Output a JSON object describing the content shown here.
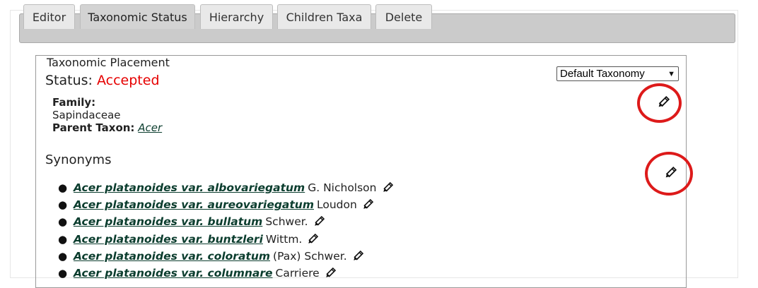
{
  "tabs": [
    {
      "label": "Editor"
    },
    {
      "label": "Taxonomic Status"
    },
    {
      "label": "Hierarchy"
    },
    {
      "label": "Children Taxa"
    },
    {
      "label": "Delete"
    }
  ],
  "active_tab": "Taxonomic Status",
  "placement": {
    "legend": "Taxonomic Placement",
    "status_label": "Status:",
    "status_value": "Accepted",
    "taxonomy_select": "Default Taxonomy",
    "family_label": "Family:",
    "family_value": "Sapindaceae",
    "parent_label": "Parent Taxon:",
    "parent_value": "Acer"
  },
  "synonyms": {
    "title": "Synonyms",
    "items": [
      {
        "name": "Acer platanoides var. albovariegatum",
        "author": "G. Nicholson"
      },
      {
        "name": "Acer platanoides var. aureovariegatum",
        "author": "Loudon"
      },
      {
        "name": "Acer platanoides var. bullatum",
        "author": "Schwer."
      },
      {
        "name": "Acer platanoides var. buntzleri",
        "author": "Wittm."
      },
      {
        "name": "Acer platanoides var. coloratum",
        "author": "(Pax) Schwer."
      },
      {
        "name": "Acer platanoides var. columnare",
        "author": "Carriere"
      }
    ]
  },
  "colors": {
    "status_accepted": "#e60000",
    "link": "#0b3d2e",
    "highlight_circle": "#dd1a1a"
  },
  "icons": [
    "pencil-edit-icon"
  ]
}
